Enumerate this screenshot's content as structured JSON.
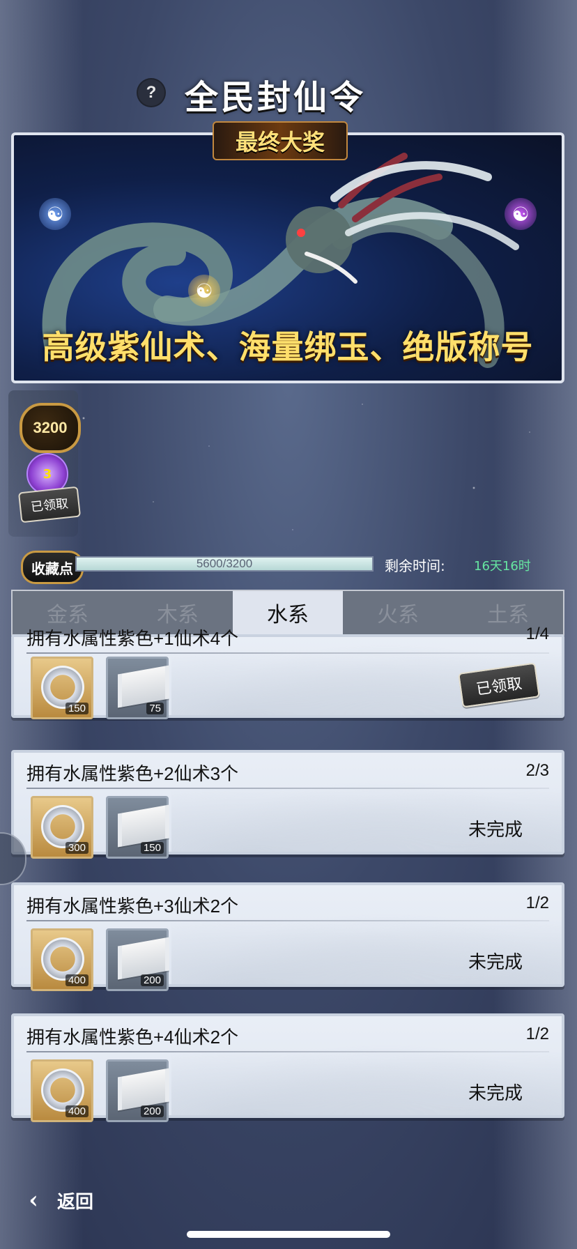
{
  "header": {
    "help_label": "?",
    "title": "全民封仙令"
  },
  "banner": {
    "tag": "最终大奖",
    "rewards_text": "高级紫仙术、海量绑玉、绝版称号"
  },
  "left_reward": {
    "points": "3200",
    "icon_label": "3",
    "claimed_label": "已领取"
  },
  "progress": {
    "label": "收藏点",
    "value_text": "5600/3200",
    "fill_fraction": 1,
    "time_label": "剩余时间:",
    "time_value": "16天16时"
  },
  "tabs": [
    {
      "label": "金系",
      "active": false
    },
    {
      "label": "木系",
      "active": false
    },
    {
      "label": "水系",
      "active": true
    },
    {
      "label": "火系",
      "active": false
    },
    {
      "label": "土系",
      "active": false
    }
  ],
  "tasks": [
    {
      "title": "拥有水属性紫色+1仙术4个",
      "progress": "1/4",
      "rewards": [
        {
          "icon": "ring-icon",
          "qty": "150"
        },
        {
          "icon": "scroll-icon",
          "qty": "75"
        }
      ],
      "status": "已领取"
    },
    {
      "title": "拥有水属性紫色+2仙术3个",
      "progress": "2/3",
      "rewards": [
        {
          "icon": "ring-icon",
          "qty": "300"
        },
        {
          "icon": "scroll-icon",
          "qty": "150"
        }
      ],
      "status": "未完成"
    },
    {
      "title": "拥有水属性紫色+3仙术2个",
      "progress": "1/2",
      "rewards": [
        {
          "icon": "ring-icon",
          "qty": "400"
        },
        {
          "icon": "scroll-icon",
          "qty": "200"
        }
      ],
      "status": "未完成"
    },
    {
      "title": "拥有水属性紫色+4仙术2个",
      "progress": "1/2",
      "rewards": [
        {
          "icon": "ring-icon",
          "qty": "400"
        },
        {
          "icon": "scroll-icon",
          "qty": "200"
        }
      ],
      "status": "未完成"
    }
  ],
  "footer": {
    "back_label": "返回"
  }
}
